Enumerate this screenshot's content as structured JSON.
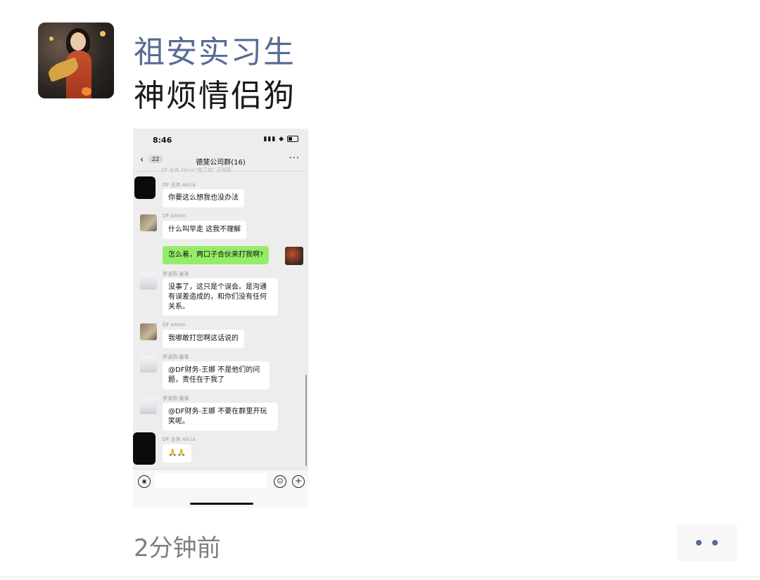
{
  "post": {
    "author": "祖安实习生",
    "text": "神烦情侣狗",
    "time": "2分钟前"
  },
  "screenshot": {
    "status_time": "8:46",
    "status_icons": "all ◆",
    "header": {
      "back_icon": "‹",
      "back_count": "22",
      "title": "德斐公司群(16)",
      "more_icon": "···"
    },
    "system_hint": "DF 业务 Alicia \"拍了拍\" 王晓燕",
    "messages": [
      {
        "sender": "DF 业务 Alicia",
        "text": "你要这么想我也没办法"
      },
      {
        "sender": "DF   simon",
        "text": "什么叫早走 这我不理解"
      },
      {
        "sender": "",
        "text": "怎么着，两口子合伙来打我啊?"
      },
      {
        "sender": "罗淑燕-董事",
        "text_lines": [
          "没事了，这只是个误会。是沟通",
          "有误差造成的，和你们没有任何",
          "关系。"
        ]
      },
      {
        "sender": "DF   simon",
        "text": "我哪敢打您啊这话说的"
      },
      {
        "sender": "罗淑燕-董事",
        "text_lines": [
          "@DF财务-王娜 不是他们的问",
          "题，责任在于我了"
        ]
      },
      {
        "sender": "罗淑燕-董事",
        "text_lines": [
          "@DF财务-王娜 不要在群里开玩",
          "笑呢。"
        ]
      },
      {
        "sender": "DF 业务 Alicia",
        "text": "🙏🙏"
      }
    ],
    "input": {
      "voice_icon": "◉",
      "emoji_icon": "☺",
      "plus_icon": "+"
    }
  },
  "colors": {
    "author": "#576b95",
    "bubble_me": "#95ec69",
    "timestamp": "#7f7f7f"
  }
}
